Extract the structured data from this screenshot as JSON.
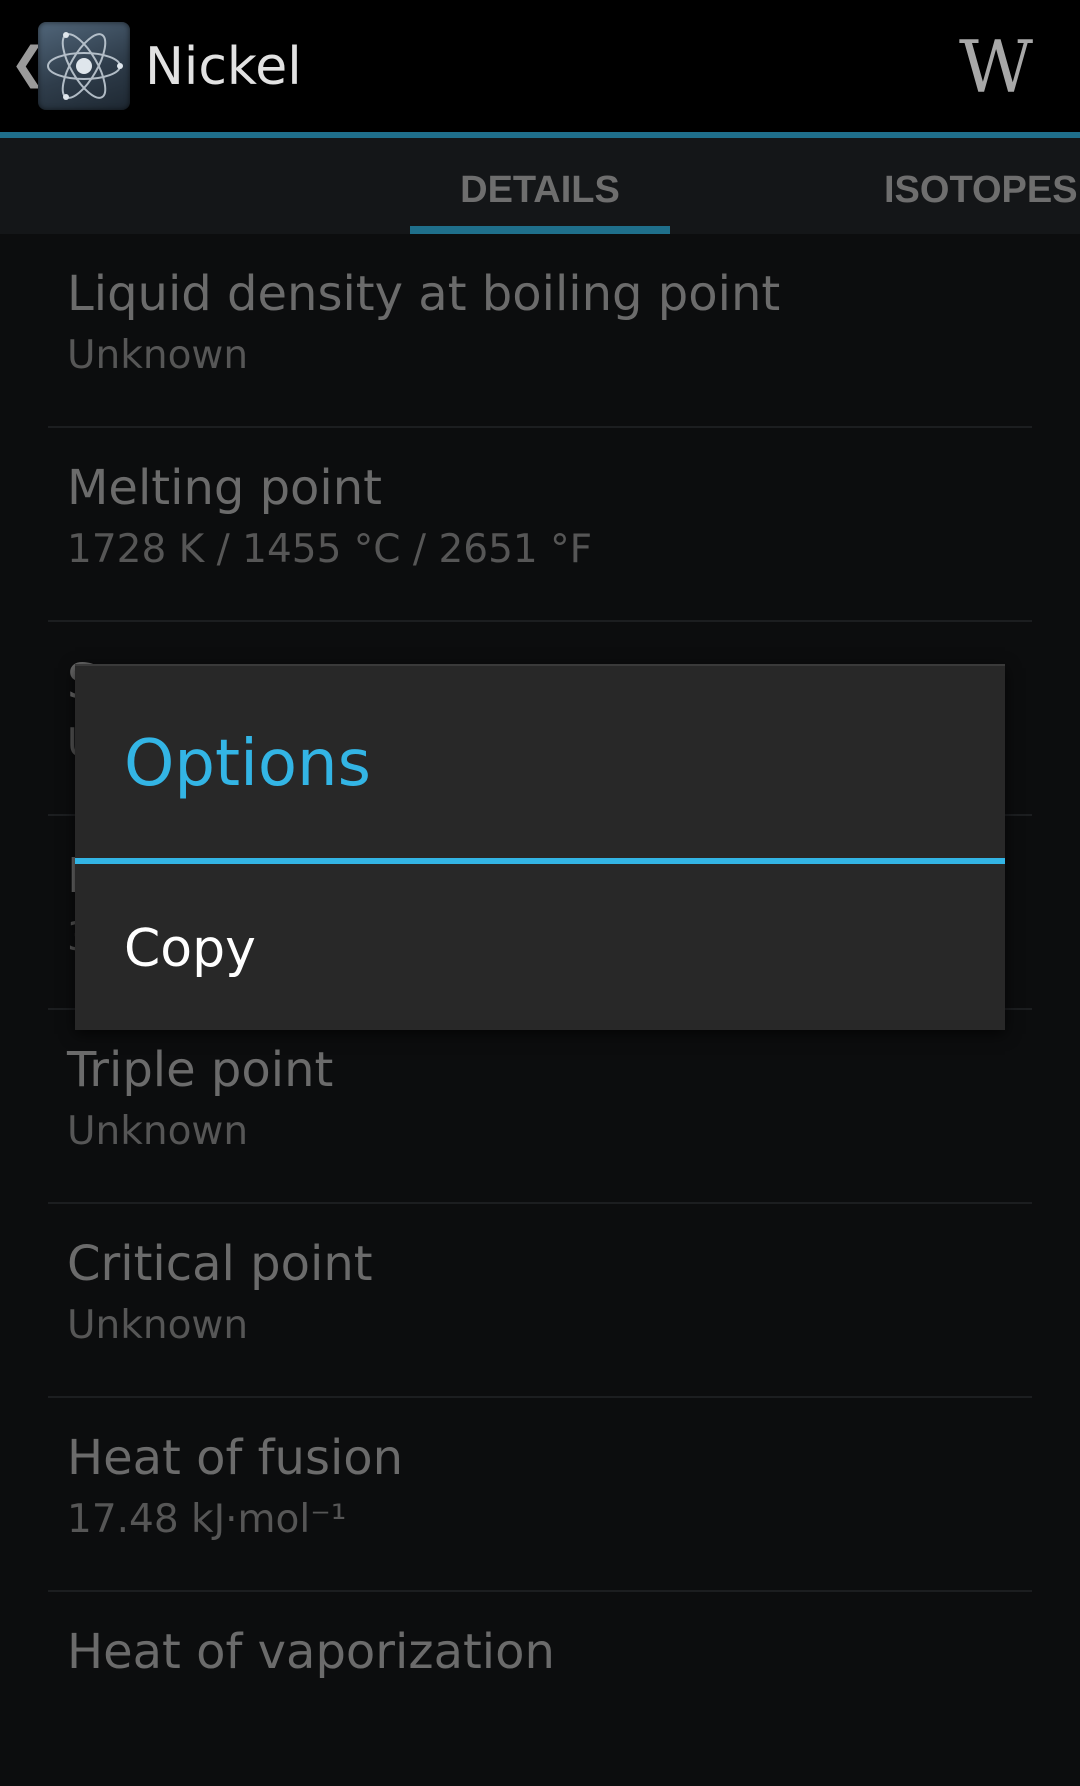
{
  "action_bar": {
    "title": "Nickel",
    "up_icon": "chevron-left-icon",
    "app_icon": "atom-icon",
    "wiki_label": "W",
    "accent_color": "#1f6f8b"
  },
  "tabs": [
    {
      "label": "DETAILS",
      "selected": true
    },
    {
      "label": "ISOTOPES",
      "selected": false
    }
  ],
  "properties": [
    {
      "label": "Liquid density at boiling point",
      "value": "Unknown"
    },
    {
      "label": "Melting point",
      "value": "1728 K / 1455 °C / 2651 °F"
    },
    {
      "label": "S",
      "value": "U"
    },
    {
      "label": "B",
      "value": "3"
    },
    {
      "label": "Triple point",
      "value": "Unknown"
    },
    {
      "label": "Critical point",
      "value": "Unknown"
    },
    {
      "label": "Heat of fusion",
      "value": "17.48 kJ·mol⁻¹"
    },
    {
      "label": "Heat of vaporization",
      "value": ""
    }
  ],
  "dialog": {
    "title": "Options",
    "items": [
      {
        "label": "Copy"
      }
    ],
    "accent_color": "#33b5e5"
  }
}
